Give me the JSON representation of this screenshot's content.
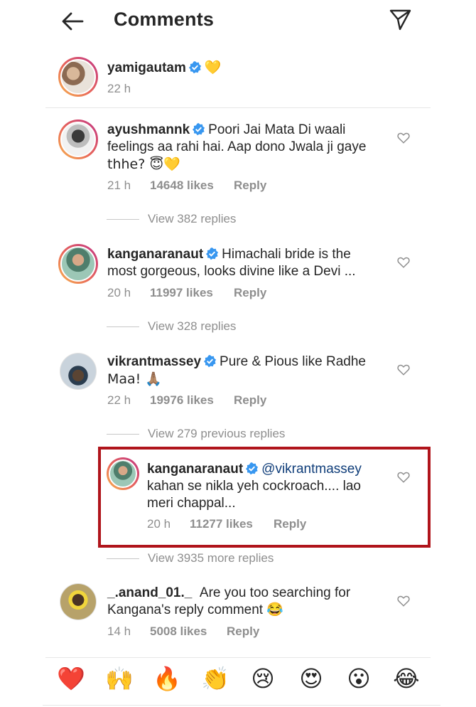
{
  "header": {
    "title": "Comments",
    "back_icon": "arrow-left-icon",
    "send_icon": "paper-plane-icon"
  },
  "caption": {
    "username": "yamigautam",
    "emoji": "💛",
    "time": "22 h"
  },
  "comments": [
    {
      "username": "ayushmannk",
      "text_line1": "Poori Jai Mata Di waali",
      "text_line2": "feelings aa rahi hai. Aap dono Jwala ji gaye",
      "text_line3": "thhe? 😇💛",
      "time": "21 h",
      "likes": "14648 likes",
      "reply": "Reply",
      "view_replies": "View 382 replies"
    },
    {
      "username": "kanganaranaut",
      "text_line1": "Himachali bride is the",
      "text_line2": "most gorgeous, looks divine like a Devi ...",
      "time": "20 h",
      "likes": "11997 likes",
      "reply": "Reply",
      "view_replies": "View 328 replies"
    },
    {
      "username": "vikrantmassey",
      "text_line1": "Pure & Pious like Radhe",
      "text_line2": "Maa! 🙏🏽",
      "time": "22 h",
      "likes": "19976 likes",
      "reply": "Reply",
      "view_replies": "View 279 previous replies"
    },
    {
      "username": "kanganaranaut",
      "mention": "@vikrantmassey",
      "text_line1": "kahan se nikla yeh cockroach.... lao",
      "text_line2": "meri chappal...",
      "time": "20 h",
      "likes": "11277 likes",
      "reply": "Reply",
      "view_replies": "View 3935 more replies"
    },
    {
      "username": "_.anand_01._",
      "text_line1": "Are you too searching for",
      "text_line2": "Kangana's reply comment 😂",
      "time": "14 h",
      "likes": "5008 likes",
      "reply": "Reply"
    }
  ],
  "emoji_bar": [
    "❤️",
    "🙌",
    "🔥",
    "👏",
    "😢",
    "😍",
    "😮",
    "😂"
  ],
  "colors": {
    "text": "#262626",
    "secondary": "#8e8e8e",
    "verified": "#3897f0",
    "mention": "#0f3d79",
    "highlight": "#b0141b"
  }
}
